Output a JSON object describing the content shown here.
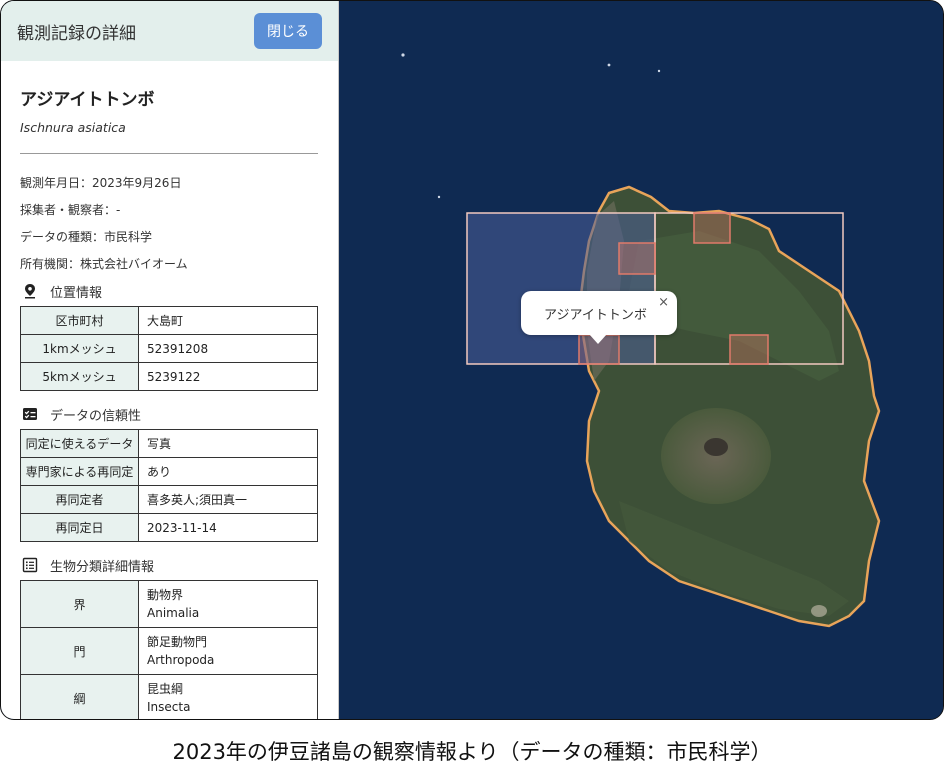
{
  "panel": {
    "title": "観測記録の詳細",
    "close_label": "閉じる",
    "species_name": "アジアイトトンボ",
    "scientific_name": "Ischnura asiatica",
    "meta": [
      "観測年月日：2023年9月26日",
      "採集者・観察者：-",
      "データの種類：市民科学",
      "所有機関：株式会社バイオーム"
    ],
    "location": {
      "heading": "位置情報",
      "icon": "map-pin-icon",
      "rows": [
        {
          "key": "区市町村",
          "value": "大島町"
        },
        {
          "key": "1kmメッシュ",
          "value": "52391208"
        },
        {
          "key": "5kmメッシュ",
          "value": "5239122"
        }
      ]
    },
    "reliability": {
      "heading": "データの信頼性",
      "icon": "checklist-icon",
      "rows": [
        {
          "key": "同定に使えるデータ",
          "value": "写真"
        },
        {
          "key": "専門家による再同定",
          "value": "あり"
        },
        {
          "key": "再同定者",
          "value": "喜多英人;須田真一"
        },
        {
          "key": "再同定日",
          "value": "2023-11-14"
        }
      ]
    },
    "taxonomy": {
      "heading": "生物分類詳細情報",
      "icon": "list-icon",
      "rows": [
        {
          "key": "界",
          "value": "動物界",
          "value_sci": "Animalia"
        },
        {
          "key": "門",
          "value": "節足動物門",
          "value_sci": "Arthropoda"
        },
        {
          "key": "綱",
          "value": "昆虫綱",
          "value_sci": "Insecta"
        }
      ]
    }
  },
  "map": {
    "popup_label": "アジアイトトンボ",
    "popup_close": "×",
    "colors": {
      "sea": "#0f2a52",
      "coast": "#e8a45a",
      "mesh_5km": "#f2c9c0",
      "mesh_1km": "#e07a6a"
    }
  },
  "caption": "2023年の伊豆諸島の観察情報より（データの種類：市民科学）"
}
